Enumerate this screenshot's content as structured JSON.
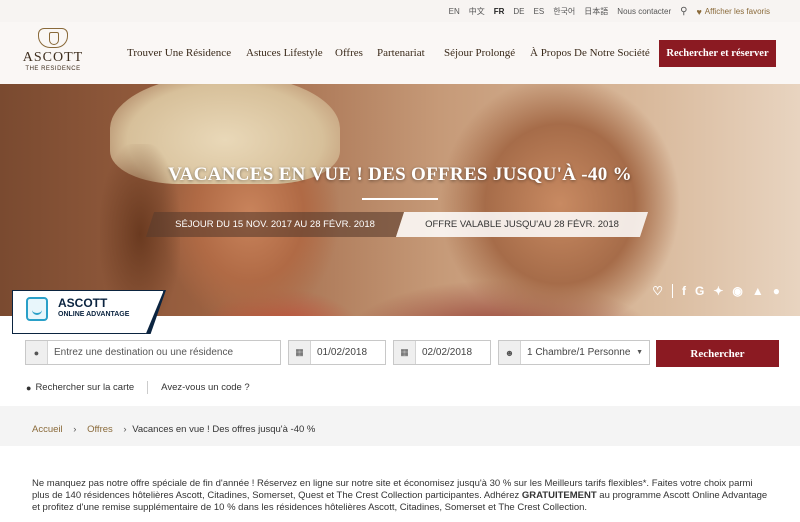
{
  "topbar": {
    "languages": [
      "EN",
      "中文",
      "FR",
      "DE",
      "ES",
      "한국어",
      "日本語"
    ],
    "active_language": "FR",
    "contact": "Nous contacter",
    "favorites": "Afficher les favoris"
  },
  "header": {
    "logo_name": "ASCOTT",
    "logo_sub": "THE RESIDENCE",
    "nav": [
      "Trouver Une Résidence",
      "Astuces Lifestyle",
      "Offres",
      "Partenariat",
      "Séjour Prolongé",
      "À Propos De Notre Société"
    ],
    "book_button": "Rechercher et réserver"
  },
  "hero": {
    "title": "VACANCES EN VUE ! DES OFFRES JUSQU'À -40 %",
    "stay_dates": "SÉJOUR DU 15 NOV. 2017 AU 28 FÉVR. 2018",
    "offer_valid": "OFFRE VALABLE JUSQU'AU 28 FÉVR. 2018",
    "social_icons": [
      "heart-icon",
      "facebook-icon",
      "google-icon",
      "twitter-icon",
      "weibo-icon",
      "share-icon",
      "wechat-icon"
    ]
  },
  "badge": {
    "title": "ASCOTT",
    "subtitle": "ONLINE ADVANTAGE"
  },
  "booking": {
    "destination_placeholder": "Entrez une destination ou une résidence",
    "checkin": "01/02/2018",
    "checkout": "02/02/2018",
    "rooms": "1 Chambre/1 Personne",
    "search_button": "Rechercher",
    "map_link": "Rechercher sur la carte",
    "code_link": "Avez-vous un code ?"
  },
  "breadcrumb": {
    "home": "Accueil",
    "offers": "Offres",
    "current": "Vacances en vue ! Des offres jusqu'à -40 %"
  },
  "content": {
    "part1": "Ne manquez pas notre offre spéciale de fin d'année ! Réservez en ligne sur notre site et économisez jusqu'à 30 % sur les Meilleurs tarifs flexibles*. Faites votre choix parmi plus de 140 résidences hôtelières Ascott, Citadines, Somerset, Quest et The Crest Collection participantes. Adhérez ",
    "bold": "GRATUITEMENT",
    "part2": " au programme Ascott Online Advantage et profitez d'une remise supplémentaire de 10 % dans les résidences hôtelières Ascott, Citadines, Somerset et The Crest Collection."
  },
  "colors": {
    "brand_red": "#8b1a22",
    "gold": "#8a6a3a",
    "navy": "#0b2440"
  }
}
